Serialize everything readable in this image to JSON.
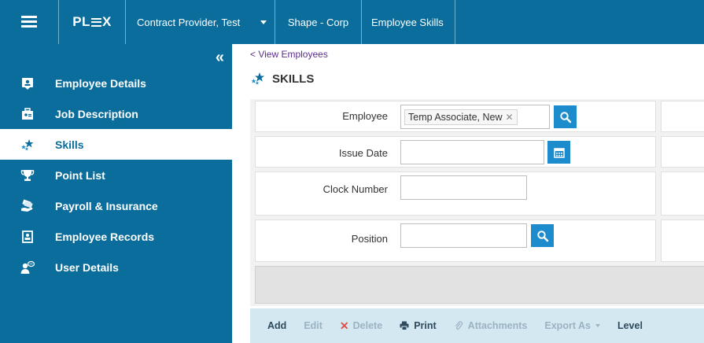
{
  "header": {
    "logo_text": "PLEX",
    "provider": "Contract Provider, Test",
    "plant": "Shape - Corp",
    "app_name": "Employee Skills"
  },
  "sidebar": {
    "collapse_glyph": "«",
    "items": [
      {
        "label": "Employee Details",
        "icon": "id-card-icon"
      },
      {
        "label": "Job Description",
        "icon": "briefcase-icon"
      },
      {
        "label": "Skills",
        "icon": "stars-icon",
        "active": true
      },
      {
        "label": "Point List",
        "icon": "trophy-icon"
      },
      {
        "label": "Payroll & Insurance",
        "icon": "money-hand-icon"
      },
      {
        "label": "Employee Records",
        "icon": "records-icon"
      },
      {
        "label": "User Details",
        "icon": "user-chat-icon"
      }
    ]
  },
  "main": {
    "back_link": "< View Employees",
    "page_title": "SKILLS",
    "fields": {
      "employee": {
        "label": "Employee",
        "value": "Temp Associate, New"
      },
      "issue_date": {
        "label": "Issue Date",
        "value": ""
      },
      "clock_number": {
        "label": "Clock Number",
        "value": ""
      },
      "position": {
        "label": "Position",
        "value": ""
      }
    }
  },
  "actions": {
    "add": "Add",
    "edit": "Edit",
    "delete": "Delete",
    "print": "Print",
    "attachments": "Attachments",
    "export_as": "Export As",
    "level": "Level"
  },
  "colors": {
    "brand": "#0a6d9b",
    "accent_button": "#1d8ccc",
    "action_bar": "#d4e8f2",
    "link": "#5a2e8a"
  }
}
